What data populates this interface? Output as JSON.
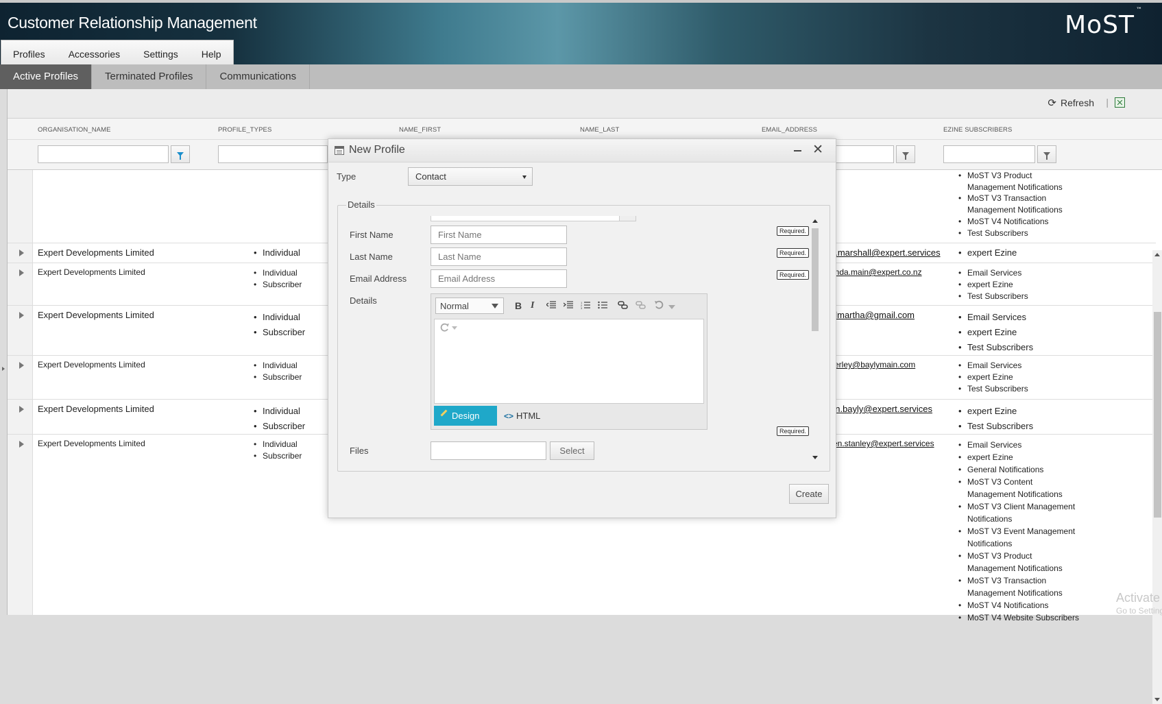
{
  "header": {
    "title": "Customer Relationship Management",
    "logo": "MoST",
    "logo_tm": "™"
  },
  "menu": [
    "Profiles",
    "Accessories",
    "Settings",
    "Help"
  ],
  "tabs": [
    "Active Profiles",
    "Terminated Profiles",
    "Communications"
  ],
  "toolbar": {
    "refresh": "Refresh",
    "separator": "|"
  },
  "columns": [
    "ORGANISATION_NAME",
    "PROFILE_TYPES",
    "NAME_FIRST",
    "NAME_LAST",
    "EMAIL_ADDRESS",
    "EZINE SUBSCRIBERS"
  ],
  "top_partial_ezine": [
    "MoST V3 Product Management Notifications",
    "MoST V3 Transaction Management Notifications",
    "MoST V4 Notifications",
    "Test Subscribers"
  ],
  "rows": [
    {
      "org": "Expert Developments Limited",
      "types": [
        "Individual"
      ],
      "email": "n.marshall@expert.services",
      "ezine": [
        "expert Ezine"
      ]
    },
    {
      "org": "Expert Developments Limited",
      "types": [
        "Individual",
        "Subscriber"
      ],
      "email": "anda.main@expert.co.nz",
      "ezine": [
        "Email Services",
        "expert Ezine",
        "Test Subscribers"
      ]
    },
    {
      "org": "Expert Developments Limited",
      "types": [
        "Individual",
        "Subscriber"
      ],
      "email": "almartha@gmail.com",
      "ezine": [
        "Email Services",
        "expert Ezine",
        "Test Subscribers"
      ]
    },
    {
      "org": "Expert Developments Limited",
      "types": [
        "Individual",
        "Subscriber"
      ],
      "email": "verley@baylymain.com",
      "ezine": [
        "Email Services",
        "expert Ezine",
        "Test Subscribers"
      ]
    },
    {
      "org": "Expert Developments Limited",
      "types": [
        "Individual",
        "Subscriber"
      ],
      "email": "an.bayly@expert.services",
      "ezine": [
        "expert Ezine",
        "Test Subscribers"
      ]
    },
    {
      "org": "Expert Developments Limited",
      "types": [
        "Individual",
        "Subscriber"
      ],
      "email": "ren.stanley@expert.services",
      "ezine": [
        "Email Services",
        "expert Ezine",
        "General Notifications",
        "MoST V3 Content Management Notifications",
        "MoST V3 Client Management Notifications",
        "MoST V3 Event Management Notifications",
        "MoST V3 Product Management Notifications",
        "MoST V3 Transaction Management Notifications",
        "MoST V4 Notifications",
        "MoST V4 Website Subscribers"
      ]
    }
  ],
  "watermark": {
    "line1": "Activate W",
    "line2": "Go to Settings"
  },
  "modal": {
    "title": "New Profile",
    "minimize": "—",
    "close": "✕",
    "type_label": "Type",
    "type_value": "Contact",
    "section": "Details",
    "first_name_label": "First Name",
    "first_name_placeholder": "First Name",
    "last_name_label": "Last Name",
    "last_name_placeholder": "Last Name",
    "email_label": "Email Address",
    "email_placeholder": "Email Address",
    "details_label": "Details",
    "required": "Required.",
    "editor_format": "Normal",
    "bold": "B",
    "italic": "I",
    "design": "Design",
    "html": "HTML",
    "html_icon": "<>",
    "files_label": "Files",
    "select": "Select",
    "create": "Create"
  }
}
